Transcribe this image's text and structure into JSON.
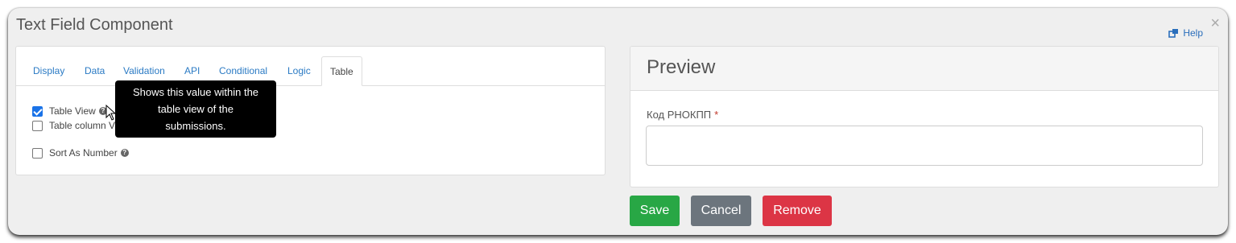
{
  "modal": {
    "title": "Text Field Component",
    "help_label": "Help",
    "close_glyph": "×"
  },
  "tabs": [
    {
      "label": "Display",
      "active": false
    },
    {
      "label": "Data",
      "active": false
    },
    {
      "label": "Validation",
      "active": false
    },
    {
      "label": "API",
      "active": false
    },
    {
      "label": "Conditional",
      "active": false
    },
    {
      "label": "Logic",
      "active": false
    },
    {
      "label": "Table",
      "active": true
    }
  ],
  "table_tab": {
    "options": [
      {
        "label": "Table View",
        "checked": true
      },
      {
        "label": "Table column V",
        "checked": false
      },
      {
        "label": "Sort As Number",
        "checked": false
      }
    ],
    "tooltip": [
      "Shows this value within the",
      "table view of the",
      "submissions."
    ]
  },
  "preview": {
    "title": "Preview",
    "field_label": "Код РНОКПП",
    "required_marker": "*",
    "field_value": ""
  },
  "actions": {
    "save": "Save",
    "cancel": "Cancel",
    "remove": "Remove"
  },
  "colors": {
    "save": "#28a745",
    "cancel": "#6c757d",
    "remove": "#dc3545",
    "link": "#2a7ac4"
  },
  "icons": {
    "help": "external-link-icon",
    "info": "question-circle-icon",
    "close": "close-icon",
    "cursor": "mouse-pointer-icon"
  }
}
